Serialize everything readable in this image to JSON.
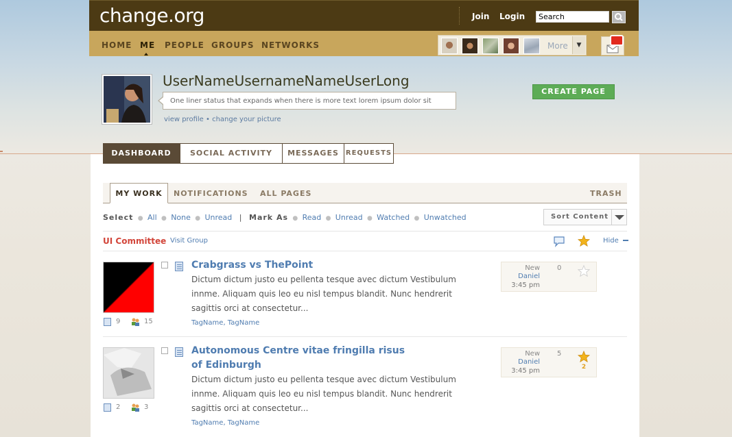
{
  "header": {
    "logo": "change.org",
    "join_label": "Join",
    "login_label": "Login",
    "search_value": "Search"
  },
  "nav": {
    "items": [
      "HOME",
      "ME",
      "PEOPLE",
      "GROUPS",
      "NETWORKS"
    ],
    "more_label": "More"
  },
  "profile": {
    "username": "UserNameUsernameNameUserLong",
    "status": "One liner status that expands when there is more text lorem ipsum dolor sit",
    "view_profile": "view profile",
    "separator": "•",
    "change_picture": "change your picture",
    "create_page": "CREATE PAGE"
  },
  "tabs": {
    "main": [
      "DASHBOARD",
      "SOCIAL ACTIVITY",
      "MESSAGES",
      "REQUESTS"
    ],
    "sub": [
      "MY WORK",
      "NOTIFICATIONS",
      "ALL PAGES"
    ],
    "trash": "TRASH"
  },
  "toolbar": {
    "select_label": "Select",
    "select_options": [
      "All",
      "None",
      "Unread"
    ],
    "divider": "|",
    "markas_label": "Mark As",
    "markas_options": [
      "Read",
      "Unread",
      "Watched",
      "Unwatched"
    ],
    "sort_label": "Sort Content"
  },
  "group": {
    "name": "UI Committee",
    "visit_label": "Visit Group",
    "hide_label": "Hide"
  },
  "items": [
    {
      "title_line1": "Crabgrass vs ThePoint",
      "title_line2": "",
      "body": [
        "Dictum dictum justo eu pellenta tesque avec dictum Vestibulum",
        "innme. Aliquam quis leo eu nisl tempus blandit. Nunc hendrerit",
        "sagittis orci at consectetur..."
      ],
      "tags": [
        "TagName",
        "TagName"
      ],
      "doc_count": "9",
      "people_count": "15",
      "status": "New",
      "user": "Daniel",
      "time": "3:45 pm",
      "comments": "0",
      "starred": false,
      "stars": ""
    },
    {
      "title_line1": "Autonomous Centre vitae fringilla risus",
      "title_line2": "of Edinburgh",
      "body": [
        "Dictum dictum justo eu pellenta tesque avec dictum Vestibulum",
        "innme. Aliquam quis leo eu nisl tempus blandit. Nunc hendrerit",
        "sagittis orci at consectetur..."
      ],
      "tags": [
        "TagName",
        "TagName"
      ],
      "doc_count": "2",
      "people_count": "3",
      "status": "New",
      "user": "Daniel",
      "time": "3:45 pm",
      "comments": "5",
      "starred": true,
      "stars": "2"
    }
  ],
  "colors": {
    "topbar": "#4c3a14",
    "navbar": "#c8a65c",
    "accent_link": "#4f7cb0",
    "create_button": "#5dac56",
    "group_name": "#d2453a",
    "star": "#f2b31c"
  },
  "icons": [
    "search-icon",
    "inbox-icon",
    "notification-badge-icon",
    "document-icon",
    "people-icon",
    "comment-icon",
    "star-icon",
    "chevron-down-icon",
    "minus-icon"
  ]
}
